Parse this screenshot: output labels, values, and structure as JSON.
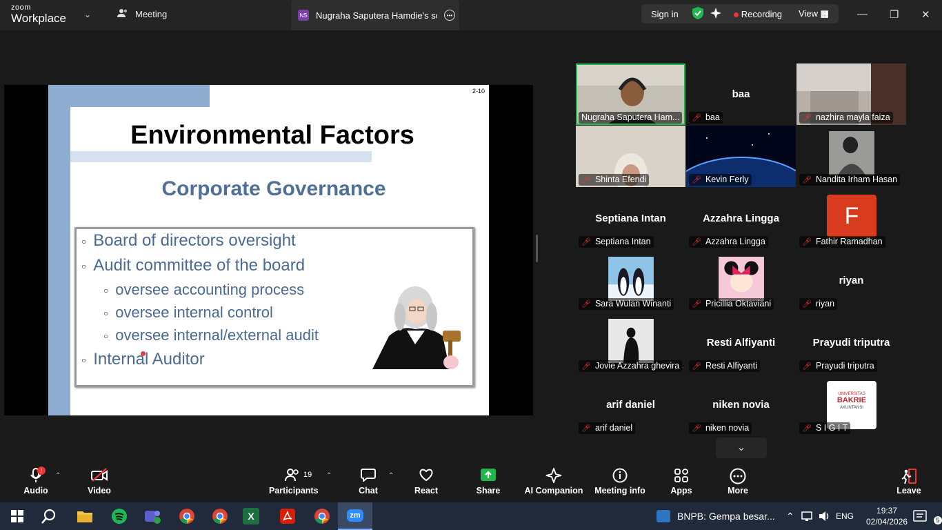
{
  "topbar": {
    "logo_top": "zoom",
    "logo_bottom": "Workplace",
    "tab_meeting": "Meeting",
    "tab_share_initials": "NS",
    "tab_share": "Nugraha Saputera Hamdie's scree",
    "sign_in": "Sign in",
    "recording": "Recording",
    "view": "View"
  },
  "slide": {
    "page": "2-10",
    "title": "Environmental Factors",
    "subtitle": "Corporate Governance",
    "bullets": [
      "Board of directors oversight",
      "Audit committee of the board",
      "oversee accounting process",
      "oversee internal control",
      "oversee internal/external audit",
      "Internal Auditor"
    ]
  },
  "participants": [
    {
      "label": "Nugraha Saputera Ham...",
      "big": ""
    },
    {
      "label": "baa",
      "big": "baa"
    },
    {
      "label": "nazhira mayla faiza",
      "big": ""
    },
    {
      "label": "Shinta Efendi",
      "big": ""
    },
    {
      "label": "Kevin Ferly",
      "big": ""
    },
    {
      "label": "Nandita Irham Hasan",
      "big": ""
    },
    {
      "label": "Septiana Intan",
      "big": "Septiana Intan"
    },
    {
      "label": "Azzahra Lingga",
      "big": "Azzahra Lingga"
    },
    {
      "label": "Fathir Ramadhan",
      "big": "F"
    },
    {
      "label": "Sara Wulan Winanti",
      "big": ""
    },
    {
      "label": "Pricillia Oktaviani",
      "big": ""
    },
    {
      "label": "riyan",
      "big": "riyan"
    },
    {
      "label": "Jovie Azzahra ghevira",
      "big": ""
    },
    {
      "label": "Resti Alfiyanti",
      "big": "Resti Alfiyanti"
    },
    {
      "label": "Prayudi triputra",
      "big": "Prayudi triputra"
    },
    {
      "label": "arif daniel",
      "big": "arif daniel"
    },
    {
      "label": "niken novia",
      "big": "niken novia"
    },
    {
      "label": "S I G I T",
      "big": ""
    }
  ],
  "logo_card": {
    "line1": "UNIVERSITAS",
    "line2": "BAKRIE",
    "line3": "AKUNTANSI"
  },
  "controls": {
    "audio": "Audio",
    "audio_badge": "!",
    "video": "Video",
    "participants": "Participants",
    "participants_count": "19",
    "chat": "Chat",
    "react": "React",
    "share": "Share",
    "ai": "AI Companion",
    "info": "Meeting info",
    "apps": "Apps",
    "more": "More",
    "leave": "Leave"
  },
  "taskbar": {
    "excel": "X",
    "zoom": "zm",
    "news": "BNPB: Gempa besar...",
    "lang": "ENG",
    "time": "19:37",
    "date": "02/04/2026",
    "notif": "5"
  },
  "colors": {
    "accent_green": "#1fb84c",
    "record_red": "#e33333",
    "slide_blue": "#4f6f96"
  }
}
